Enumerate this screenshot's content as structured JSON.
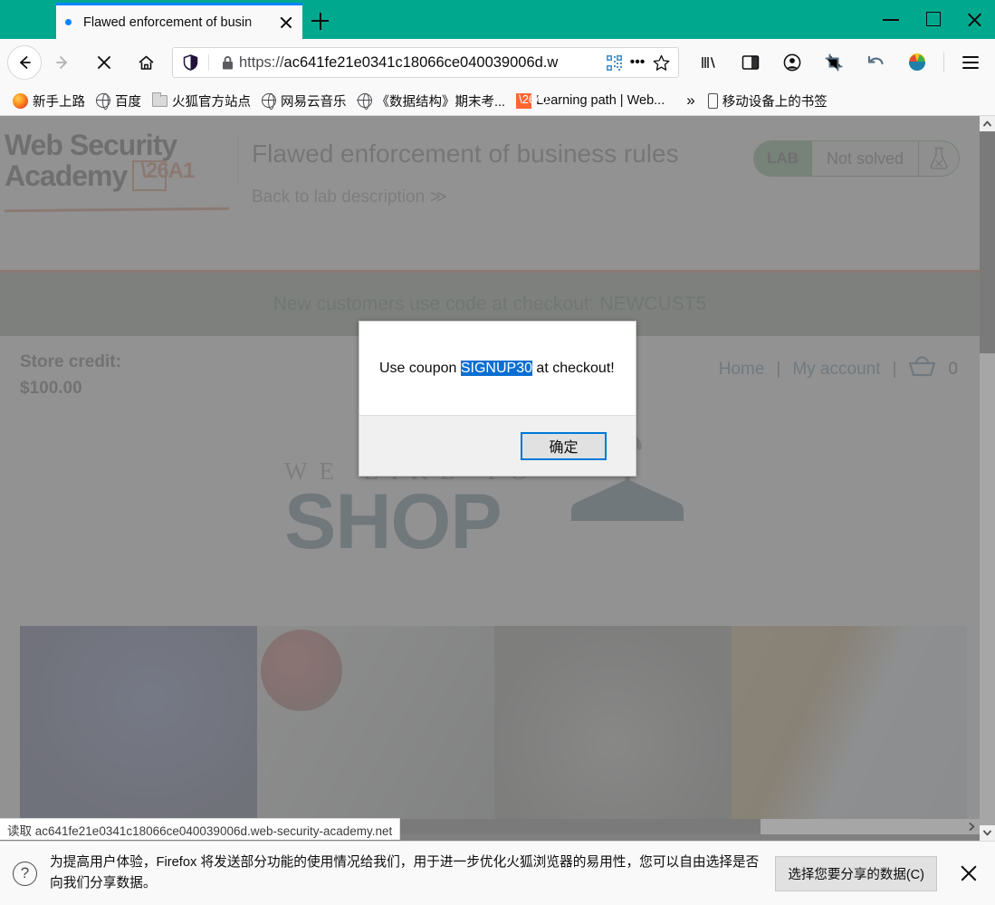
{
  "browser": {
    "tab": {
      "title": "Flawed enforcement of busin",
      "loading_dot": "•",
      "close_label": "✕"
    },
    "new_tab_label": "+",
    "window_controls": {
      "minimize": "—",
      "maximize": "□",
      "close": "✕"
    },
    "toolbar": {
      "back": "back-arrow",
      "forward": "forward-arrow",
      "stop": "stop-x",
      "home": "home",
      "shield": "tracking-protection",
      "lock": "padlock",
      "url_scheme": "https://",
      "url_host": "ac641fe21e0341c18066ce040039006d.w",
      "qr": "qr-code",
      "page_actions": "•••",
      "bookmark_star": "☆",
      "library": "library",
      "sidebar": "sidebar",
      "account": "account",
      "screenshot": "screenshot",
      "undo": "undo",
      "addon": "addon-colorful",
      "menu": "☰"
    },
    "bookmarks": [
      {
        "label": "新手上路",
        "icon": "firefox-icon"
      },
      {
        "label": "百度",
        "icon": "globe-icon"
      },
      {
        "label": "火狐官方站点",
        "icon": "folder-icon"
      },
      {
        "label": "网易云音乐",
        "icon": "globe-icon"
      },
      {
        "label": "《数据结构》期末考...",
        "icon": "globe-icon"
      },
      {
        "label": "Learning path | Web...",
        "icon": "burp-icon"
      }
    ],
    "bookmarks_overflow": "»",
    "mobile_bookmarks": {
      "label": "移动设备上的书签",
      "icon": "phone-icon"
    },
    "status_link": "读取 ac641fe21e0341c18066ce040039006d.web-security-academy.net"
  },
  "lab_header": {
    "logo_line1": "Web Security",
    "logo_line2": "Academy",
    "title": "Flawed enforcement of business rules",
    "back_link": "Back to lab description ≫",
    "badge": {
      "tag": "LAB",
      "status": "Not solved",
      "icon": "flask-icon"
    }
  },
  "shop": {
    "promo_banner": "New customers use code at checkout: NEWCUST5",
    "store_credit_label": "Store credit:",
    "store_credit_value": "$100.00",
    "nav": {
      "home": "Home",
      "account": "My account",
      "separator": "|",
      "cart_icon": "basket-icon",
      "cart_count": "0"
    },
    "logo": {
      "tagline": "WE LIKE TO",
      "name": "SHOP",
      "icon": "hanger-icon"
    },
    "products": [
      "product-image-1",
      "product-image-2",
      "product-image-3",
      "product-image-4"
    ]
  },
  "modal": {
    "text_before": "Use coupon ",
    "coupon_code": "SIGNUP30",
    "text_after": " at checkout!",
    "ok_button": "确定"
  },
  "notification": {
    "icon": "question-mark-icon",
    "message": "为提高用户体验，Firefox 将发送部分功能的使用情况给我们，用于进一步优化火狐浏览器的易用性，您可以自由选择是否向我们分享数据。",
    "button": "选择您要分享的数据(C)",
    "close": "✕"
  },
  "colors": {
    "titlebar": "#00a98e",
    "accent_orange": "#cb501d",
    "lab_green": "#42914a",
    "shop_blue": "#14527a",
    "selection_blue": "#0b6fd1",
    "promo_green": "#6f8175"
  }
}
